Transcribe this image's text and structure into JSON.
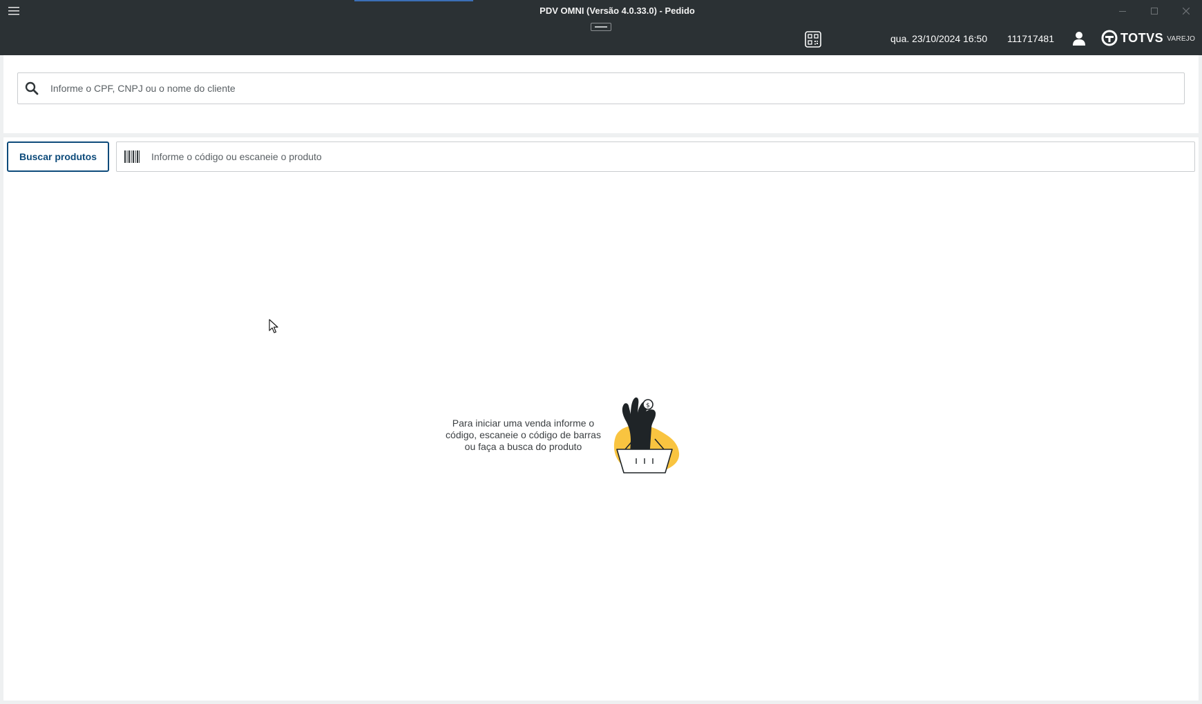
{
  "window": {
    "title": "PDV OMNI (Versão 4.0.33.0) - Pedido"
  },
  "header": {
    "datetime": "qua. 23/10/2024 16:50",
    "terminal_id": "111717481",
    "brand_name": "TOTVS",
    "brand_sub": "VAREJO",
    "icons": {
      "menu": "hamburger-menu-icon",
      "qr": "qr-code-icon",
      "user": "user-icon",
      "brand": "totvs-logo-icon"
    }
  },
  "client_search": {
    "placeholder": "Informe o CPF, CNPJ ou o nome do cliente",
    "value": ""
  },
  "product": {
    "search_button_label": "Buscar produtos",
    "placeholder": "Informe o código ou escaneie o produto",
    "value": ""
  },
  "empty_state": {
    "line1": "Para iniciar uma venda informe o",
    "line2": "código, escaneie o código de barras",
    "line3": "ou faça a busca do produto"
  },
  "colors": {
    "header_bg": "#2b3134",
    "accent": "#0c4a7a",
    "illustration_yellow": "#f9c440"
  }
}
